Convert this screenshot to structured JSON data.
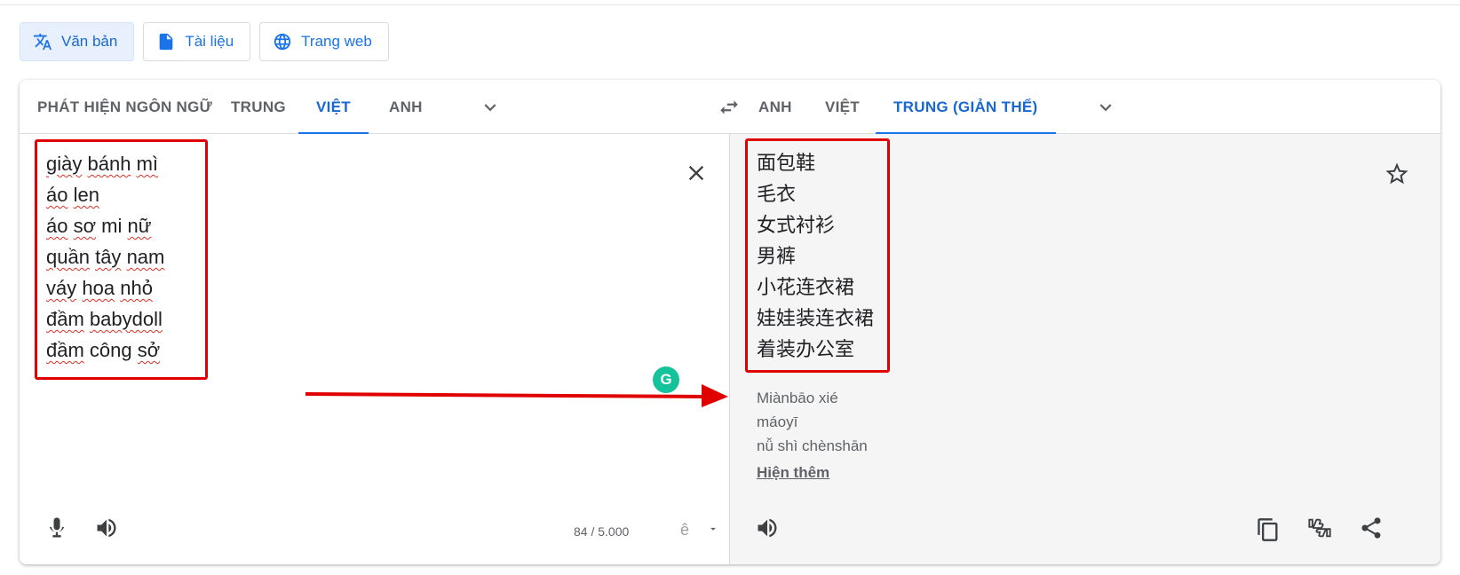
{
  "mode_tabs": [
    {
      "label": "Văn bản",
      "icon": "translate-icon",
      "active": true
    },
    {
      "label": "Tài liệu",
      "icon": "document-icon",
      "active": false
    },
    {
      "label": "Trang web",
      "icon": "globe-icon",
      "active": false
    }
  ],
  "source_langs": [
    "PHÁT HIỆN NGÔN NGỮ",
    "TRUNG",
    "VIỆT",
    "ANH"
  ],
  "target_langs": [
    "ANH",
    "VIỆT",
    "TRUNG (GIẢN THỂ)"
  ],
  "source_text": [
    [
      "giày",
      " ",
      "bánh",
      " ",
      "mì"
    ],
    [
      "áo",
      " ",
      "len"
    ],
    [
      "áo",
      " ",
      "sơ",
      " mi ",
      "nữ"
    ],
    [
      "quần",
      " ",
      "tây",
      " ",
      "nam"
    ],
    [
      "váy",
      " ",
      "hoa",
      " ",
      "nhỏ"
    ],
    [
      "đầm",
      " ",
      "babydoll"
    ],
    [
      "đầm",
      " công ",
      "sở"
    ]
  ],
  "target_text": [
    "面包鞋",
    "毛衣",
    "女式衬衫",
    "男裤",
    "小花连衣裙",
    "娃娃装连衣裙",
    "着装办公室"
  ],
  "pinyin": [
    "Miànbāo xié",
    "máoyī",
    "nǚ shì chènshān"
  ],
  "show_more": "Hiện thêm",
  "char_count": "84 / 5.000",
  "ime_glyph": "ê",
  "grammarly_letter": "G",
  "colors": {
    "accent": "#1a73e8",
    "annotation": "#e00000"
  }
}
